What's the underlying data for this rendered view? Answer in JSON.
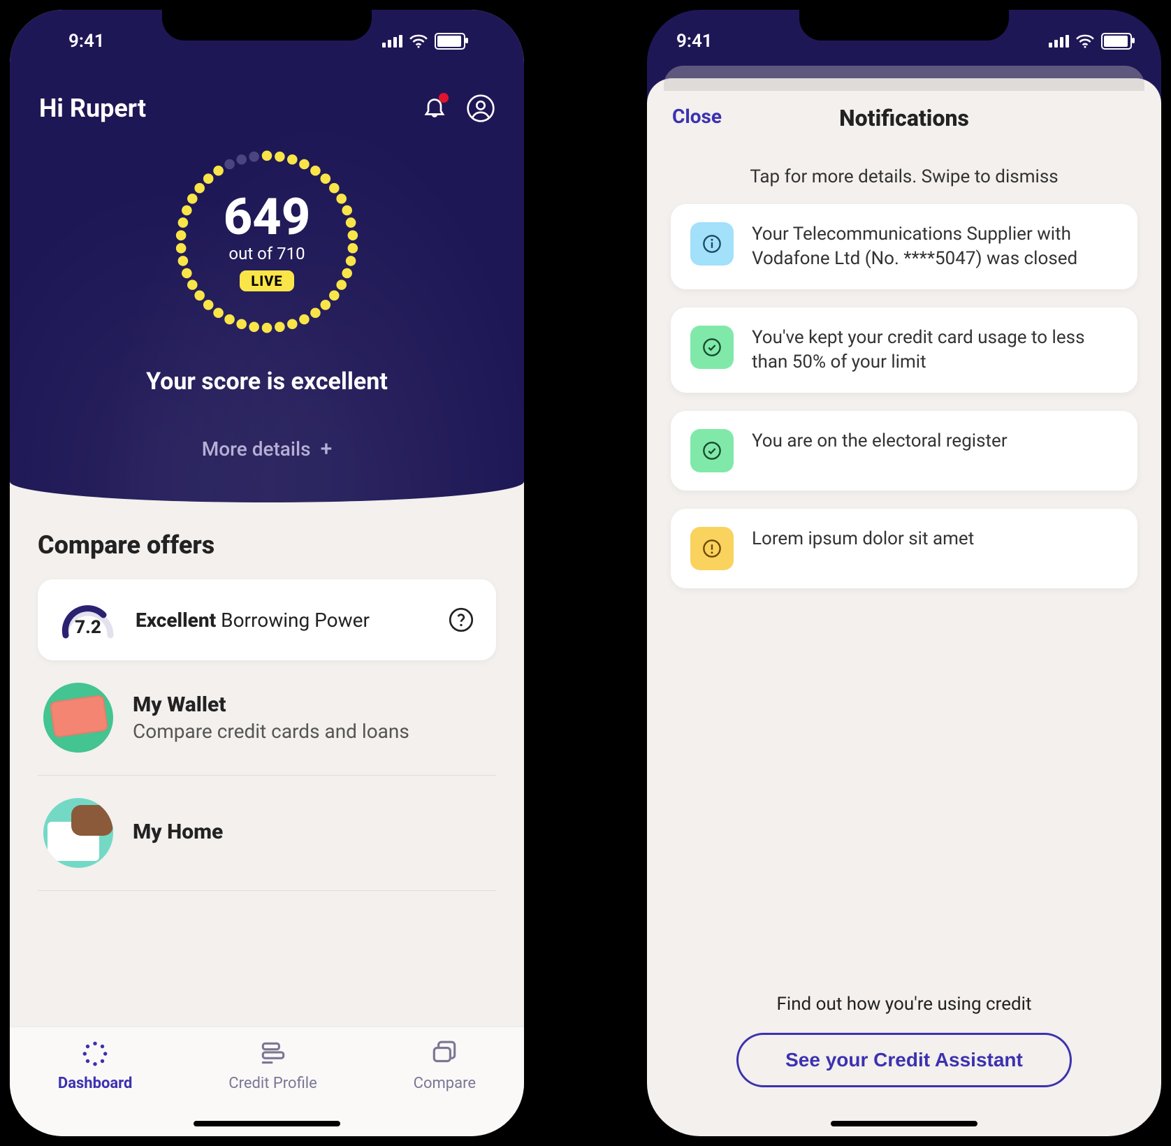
{
  "status": {
    "time": "9:41"
  },
  "dashboard": {
    "greeting": "Hi Rupert",
    "score": "649",
    "score_out_of": "out of 710",
    "live_badge": "LIVE",
    "score_message": "Your score is excellent",
    "more_details": "More details",
    "offers_title": "Compare offers",
    "borrowing_power": {
      "value": "7.2",
      "strong": "Excellent",
      "label": " Borrowing Power"
    },
    "offers": [
      {
        "title": "My Wallet",
        "subtitle": "Compare credit cards and loans",
        "icon": "wallet"
      },
      {
        "title": "My Home",
        "subtitle": "",
        "icon": "home"
      }
    ]
  },
  "tabs": [
    {
      "label": "Dashboard",
      "active": true
    },
    {
      "label": "Credit Profile",
      "active": false
    },
    {
      "label": "Compare",
      "active": false
    }
  ],
  "notifications": {
    "close": "Close",
    "title": "Notifications",
    "hint": "Tap for more details. Swipe to dismiss",
    "items": [
      {
        "type": "info",
        "text": "Your Telecommunications Supplier with Vodafone Ltd (No. ****5047) was closed"
      },
      {
        "type": "ok",
        "text": "You've kept your credit card usage to less than 50% of your limit"
      },
      {
        "type": "ok",
        "text": "You are on the electoral register"
      },
      {
        "type": "warn",
        "text": "Lorem ipsum dolor sit amet"
      }
    ],
    "footer": "Find out how you're using credit",
    "cta": "See your Credit Assistant"
  }
}
